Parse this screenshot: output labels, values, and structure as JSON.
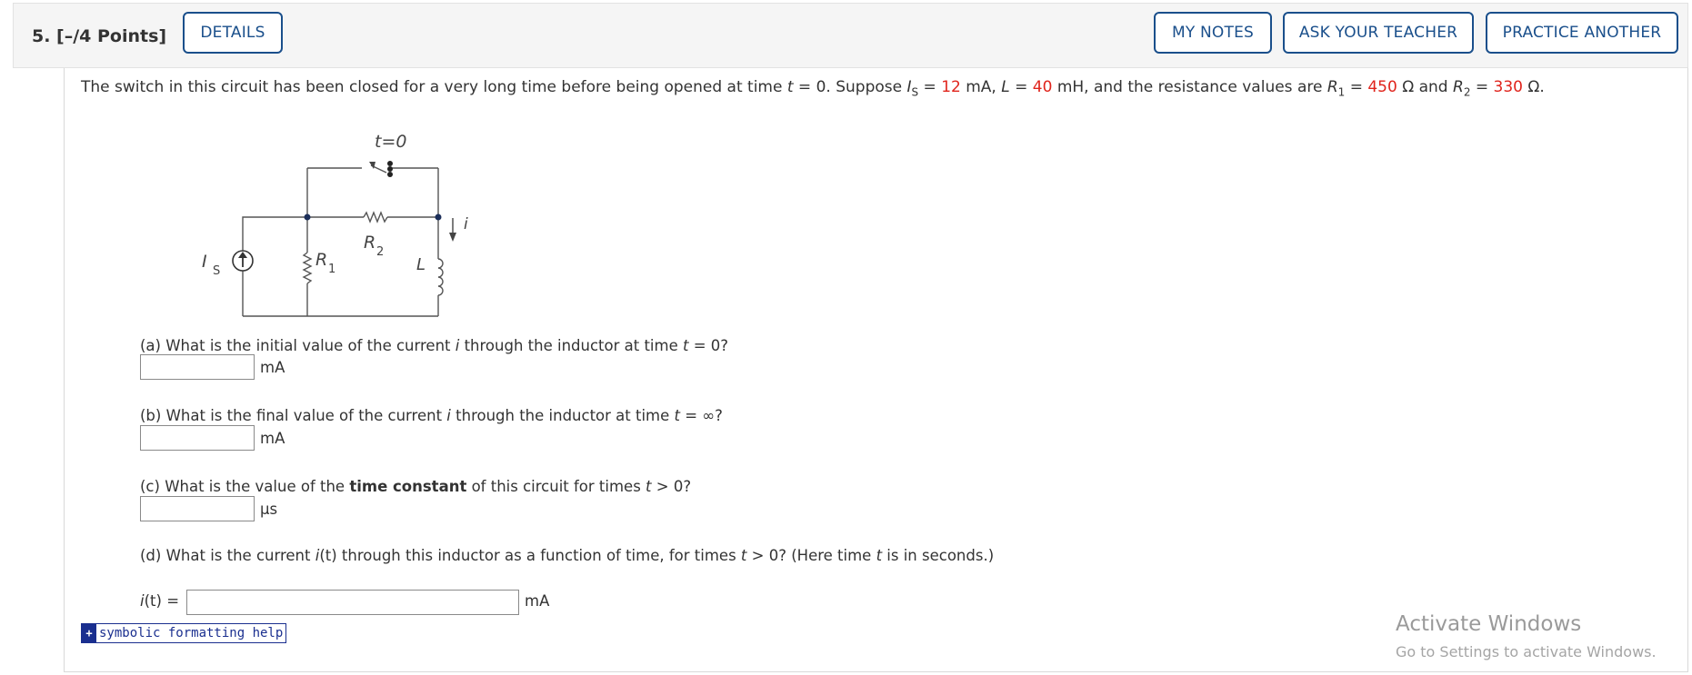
{
  "header": {
    "question_label": "5.  [–/4 Points]",
    "details_label": "DETAILS",
    "my_notes_label": "MY NOTES",
    "ask_teacher_label": "ASK YOUR TEACHER",
    "practice_label": "PRACTICE ANOTHER"
  },
  "problem": {
    "intro_1": "The switch in this circuit has been closed for a very long time before being opened at time ",
    "t_var": "t",
    "intro_2": " = 0. Suppose ",
    "is_var": "I",
    "is_sub": "S",
    "eq": " = ",
    "is_value": "12",
    "is_unit": " mA, ",
    "l_var": "L",
    "l_value": "40",
    "l_unit": " mH, and the resistance values are ",
    "r1_var": "R",
    "r1_sub": "1",
    "r1_value": "450",
    "r1_unit": " Ω and ",
    "r2_var": "R",
    "r2_sub": "2",
    "r2_value": "330",
    "r2_unit": " Ω."
  },
  "circuit": {
    "switch_label": "t=0",
    "source_label": "I",
    "source_sub": "S",
    "r1_label": "R",
    "r1_sub": "1",
    "r2_label": "R",
    "r2_sub": "2",
    "inductor_label": "L",
    "current_label": "i"
  },
  "parts": {
    "a": {
      "text_1": "(a) What is the initial value of the current ",
      "var": "i",
      "text_2": " through the inductor at time ",
      "t": "t",
      "text_3": " = 0?",
      "value": "",
      "unit": "mA"
    },
    "b": {
      "text_1": "(b) What is the final value of the current ",
      "var": "i",
      "text_2": " through the inductor at time ",
      "t": "t",
      "text_3": " = ∞?",
      "value": "",
      "unit": "mA"
    },
    "c": {
      "text_1": "(c) What is the value of the ",
      "bold": "time constant",
      "text_2": " of this circuit for times ",
      "t": "t",
      "text_3": " > 0?",
      "value": "",
      "unit": "μs"
    },
    "d": {
      "text_1": "(d) What is the current ",
      "var": "i",
      "paren": "(t)",
      "text_2": " through this inductor as a function of time, for times ",
      "t": "t",
      "text_3": " > 0? (Here time ",
      "t2": "t",
      "text_4": " is in seconds.)",
      "label_i": "i",
      "label_t": "(t)",
      "label_eq": " = ",
      "value": "",
      "unit": "mA"
    }
  },
  "help_label": "symbolic formatting help",
  "watermark": {
    "line1": "Activate Windows",
    "line2": "Go to Settings to activate Windows."
  }
}
